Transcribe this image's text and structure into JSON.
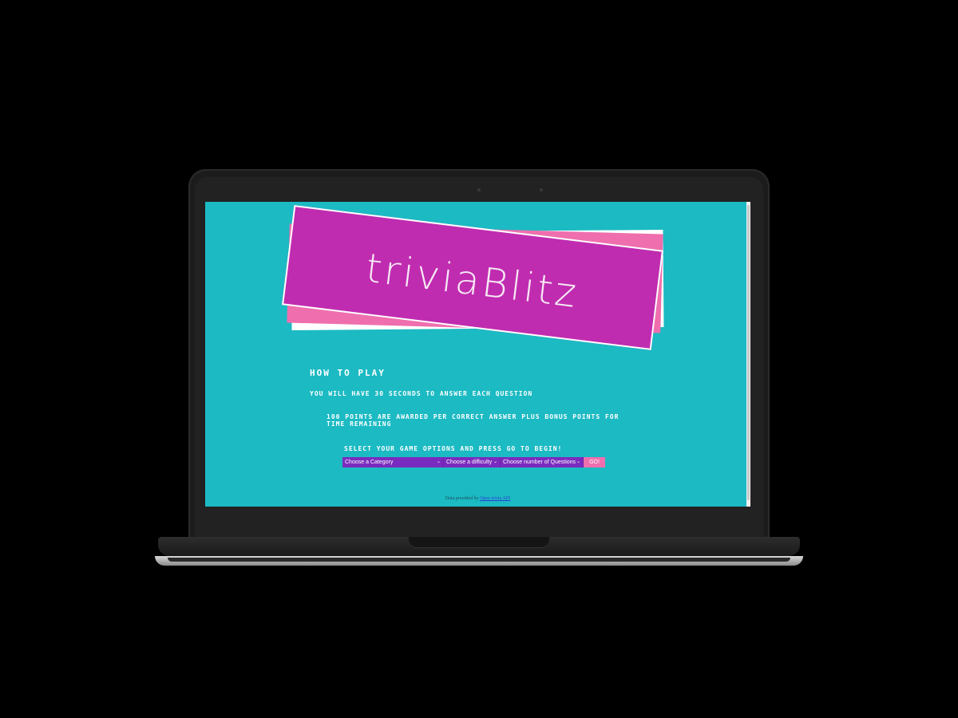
{
  "app": {
    "logo_text": "triviaBlitz"
  },
  "instructions": {
    "heading": "How to play",
    "line1": "You will have 30 seconds to answer each question",
    "line2": "100 points are awarded per correct answer plus bonus points for time remaining",
    "line3": "Select your game options and press go to begin!"
  },
  "controls": {
    "category_selected": "Choose a Category",
    "difficulty_selected": "Choose a difficulty",
    "questions_selected": "Choose number of Questions",
    "go_label": "GO!"
  },
  "footer": {
    "prefix": "Data provided by",
    "link_label": "Open trivia API"
  },
  "colors": {
    "background": "#1cbac3",
    "logo_card": "#c02cb0",
    "accent_pink": "#ef6fae",
    "select_purple": "#7a2bbf"
  }
}
